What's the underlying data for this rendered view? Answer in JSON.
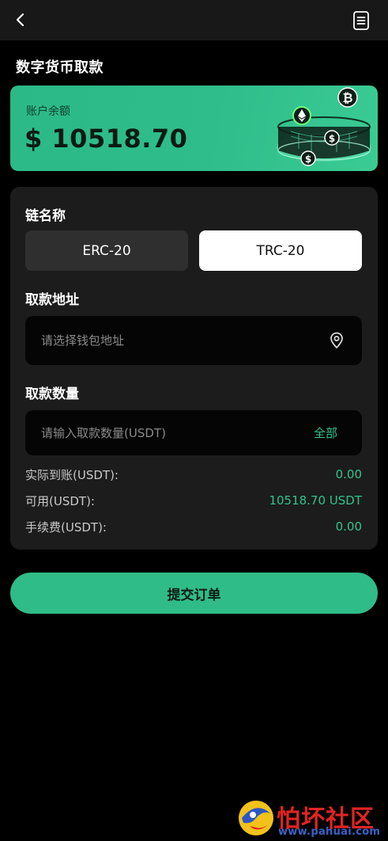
{
  "header": {
    "back_icon": "chevron-left-icon",
    "menu_icon": "document-list-icon"
  },
  "page_title": "数字货币取款",
  "balance": {
    "label": "账户余额",
    "amount": "$ 10518.70"
  },
  "chain": {
    "label": "链名称",
    "options": [
      "ERC-20",
      "TRC-20"
    ],
    "selected": "TRC-20"
  },
  "address": {
    "label": "取款地址",
    "placeholder": "请选择钱包地址",
    "icon": "location-pin-icon"
  },
  "amount": {
    "label": "取款数量",
    "placeholder": "请输入取款数量(USDT)",
    "all_label": "全部"
  },
  "summary": {
    "received_label": "实际到账(USDT):",
    "received_value": "0.00",
    "available_label": "可用(USDT):",
    "available_value": "10518.70 USDT",
    "fee_label": "手续费(USDT):",
    "fee_value": "0.00"
  },
  "submit_label": "提交订单",
  "watermark": {
    "text": "怕坏社区",
    "url": "www.pahuai.com"
  },
  "colors": {
    "accent": "#2fbc88",
    "accent_text": "#31c48d",
    "background": "#000000",
    "panel": "#1c1c1c",
    "input": "#050505"
  }
}
